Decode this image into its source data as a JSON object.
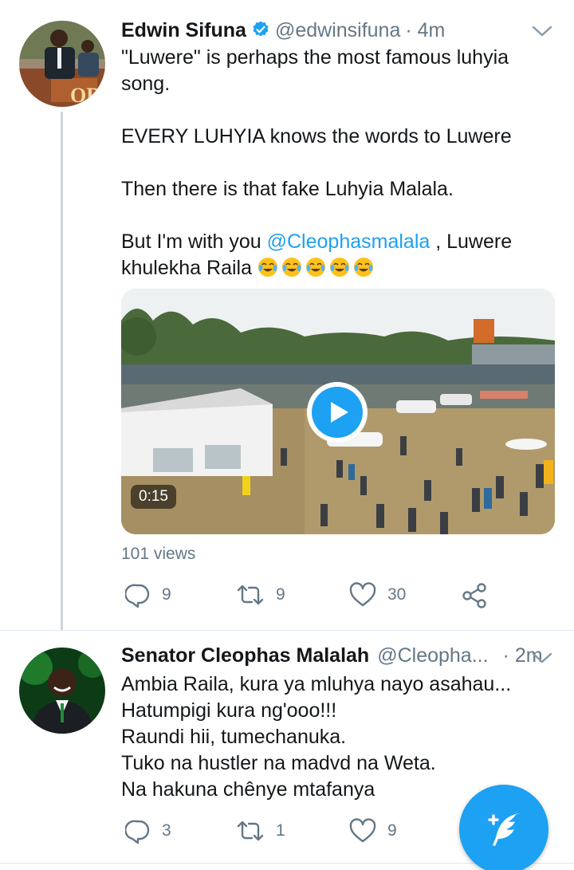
{
  "tweets": [
    {
      "name": "Edwin Sifuna",
      "handle": "@edwinsifuna",
      "time": "· 4m",
      "lines": [
        "\"Luwere\" is perhaps the most famous luhyia",
        "song.",
        "EVERY LUHYIA knows the words to Luwere",
        "Then there is that fake Luhyia Malala.",
        "But I'm with you ",
        "@Cleophasmalala",
        " , Luwere",
        "khulekha Raila"
      ],
      "video_duration": "0:15",
      "views": "101 views",
      "replies": "9",
      "retweets": "9",
      "likes": "30"
    },
    {
      "name": "Senator Cleophas Malalah",
      "handle": "@Cleopha...",
      "time": "· 2m",
      "lines": [
        "Ambia Raila, kura ya mluhya nayo asahau...",
        "Hatumpigi kura ng'ooo!!!",
        "Raundi hii, tumechanuka.",
        "Tuko na hustler na madvd na Weta.",
        "Na hakuna chênye mtafanya"
      ],
      "replies": "3",
      "retweets": "1",
      "likes": "9"
    }
  ],
  "icons": {
    "reply": "reply-icon",
    "retweet": "retweet-icon",
    "like": "heart-icon",
    "share": "share-icon",
    "compose": "compose-tweet-icon",
    "emoji": "face-with-tears-of-joy"
  },
  "colors": {
    "accent": "#1da1f2",
    "secondary_text": "#657786",
    "primary_text": "#14171a"
  }
}
